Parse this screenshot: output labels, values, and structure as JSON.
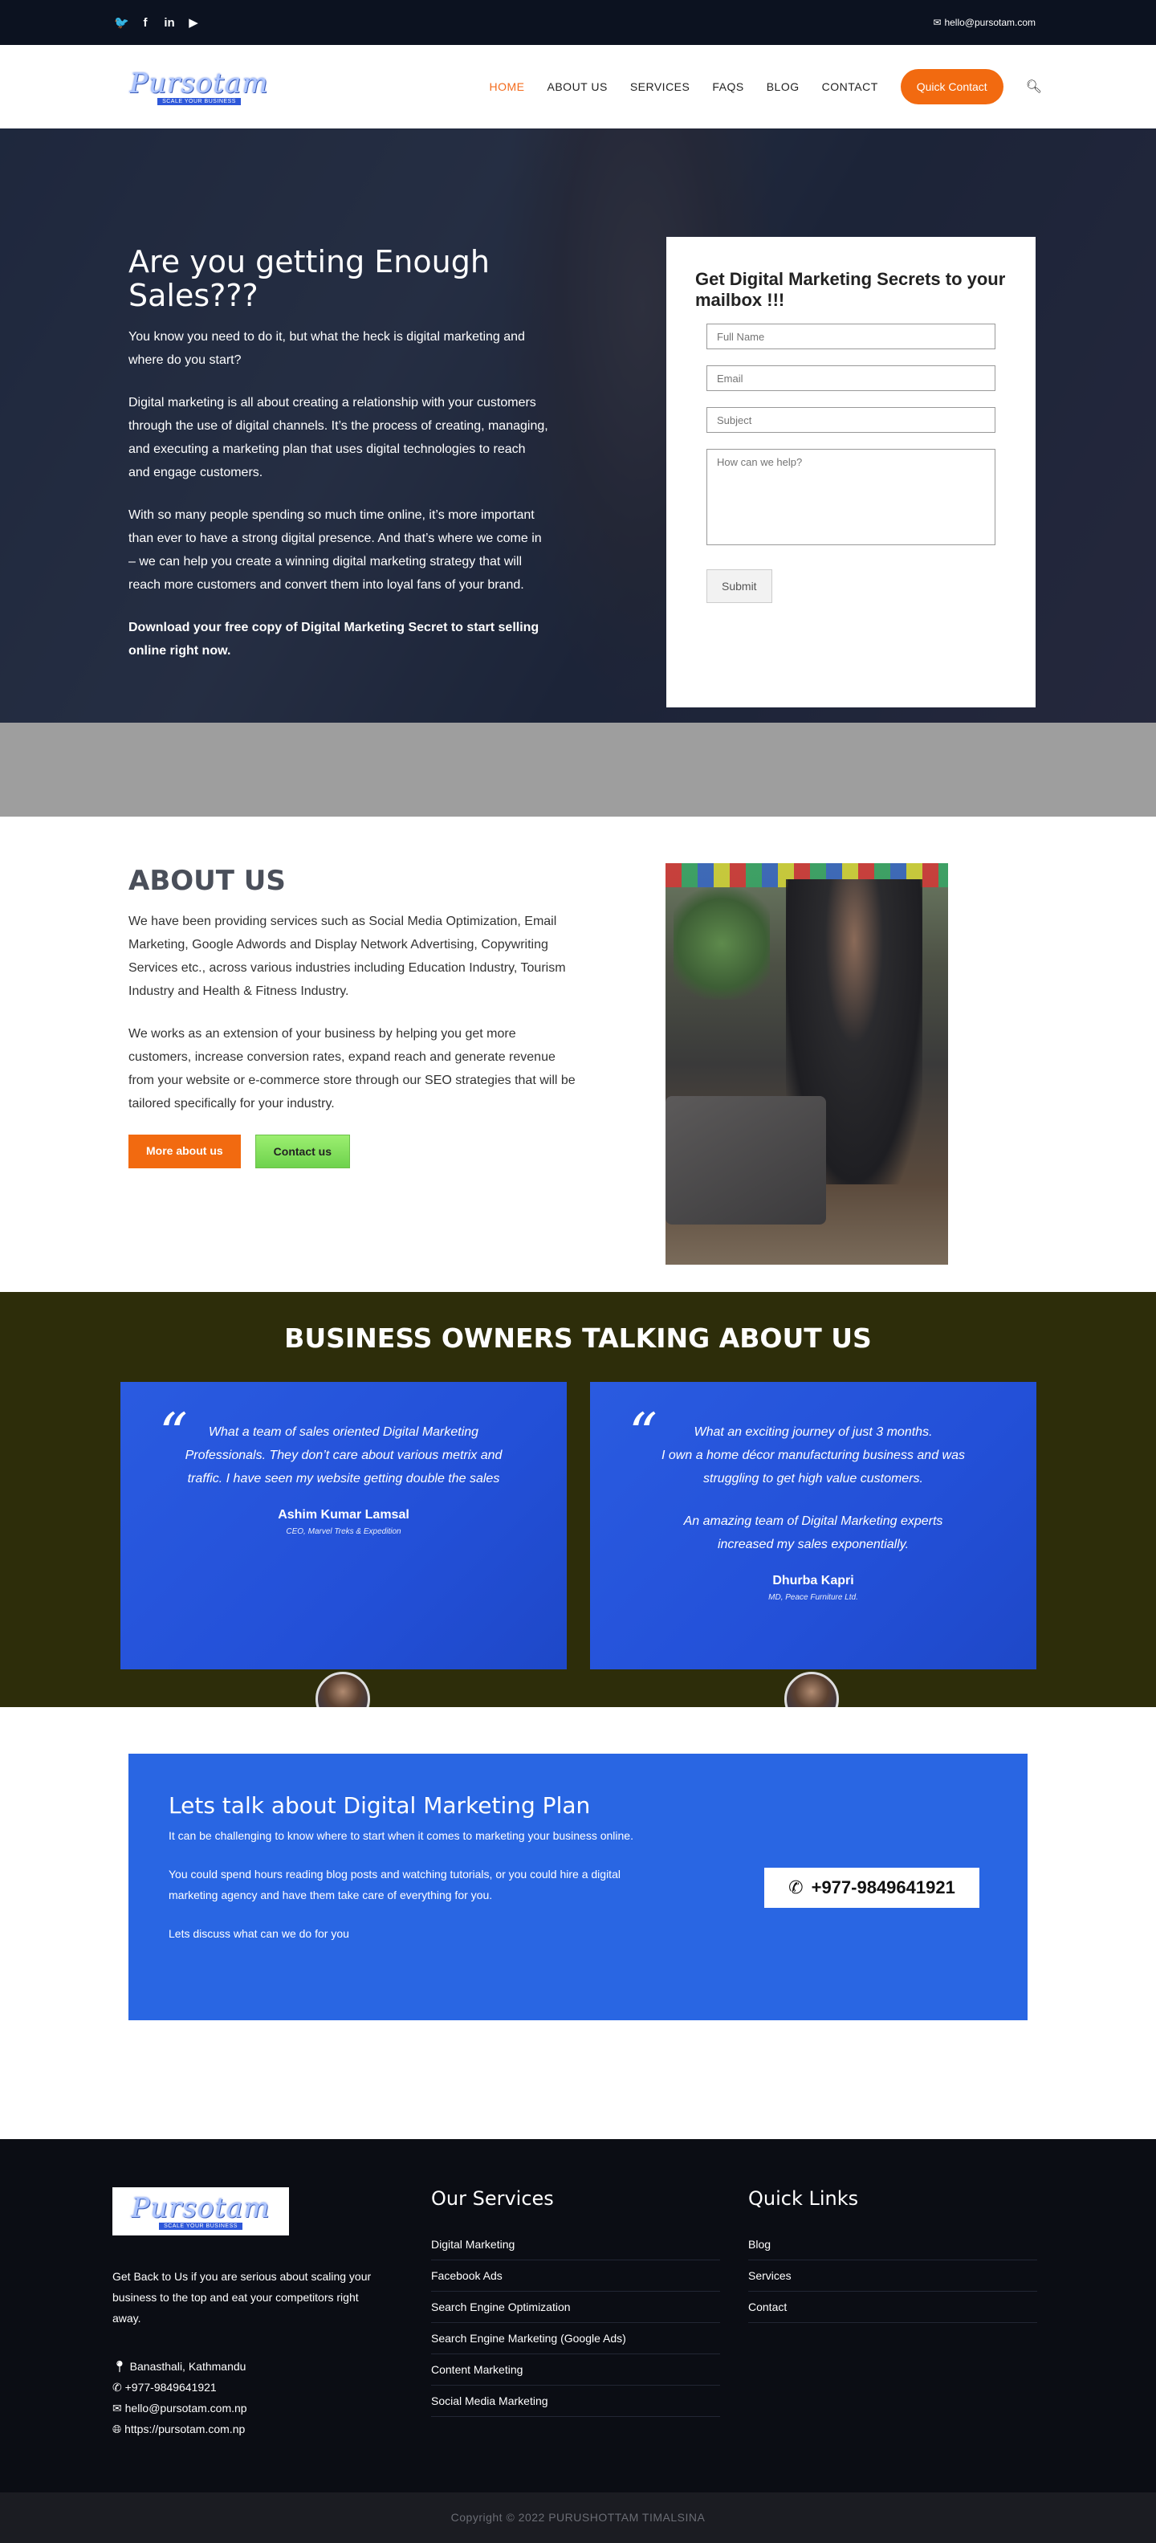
{
  "topbar": {
    "social": [
      "twitter-icon",
      "facebook-icon",
      "linkedin-icon",
      "youtube-icon"
    ],
    "social_glyphs": [
      "🐦",
      "f",
      "in",
      "▶"
    ],
    "email": "hello@pursotam.com"
  },
  "header": {
    "logo_text": "Pursotam",
    "logo_tag": "SCALE YOUR BUSINESS",
    "nav": [
      "HOME",
      "ABOUT US",
      "SERVICES",
      "FAQS",
      "BLOG",
      "CONTACT"
    ],
    "active_nav": "HOME",
    "quick_contact": "Quick Contact"
  },
  "hero": {
    "title": "Are you getting Enough Sales???",
    "p1": "You know you need to do it, but what the heck is digital marketing and where do you start?",
    "p2": "Digital marketing is all about creating a relationship with your customers through the use of digital channels. It’s the process of creating, managing, and executing a marketing plan that uses digital technologies to reach and engage customers.",
    "p3": "With so many people spending so much time online, it’s more important than ever to have a strong digital presence. And that’s where we come in – we can help you create a winning digital marketing strategy that will reach more customers and convert them into loyal fans of your brand.",
    "p4": "Download your free copy of Digital Marketing Secret to start selling online right now.",
    "form": {
      "title": "Get Digital Marketing Secrets to your mailbox !!!",
      "name_placeholder": "Full Name",
      "email_placeholder": "Email",
      "subject_placeholder": "Subject",
      "message_placeholder": "How can we help?",
      "submit": "Submit"
    }
  },
  "about": {
    "title": "ABOUT US",
    "p1": "We have been providing services such as Social Media Optimization, Email Marketing, Google Adwords and Display Network Advertising, Copywriting Services etc., across various industries including Education Industry, Tourism Industry and Health & Fitness Industry.",
    "p2": "We works as an extension of your business by helping you get more customers, increase conversion rates, expand reach and generate revenue from your website or e-commerce store through our SEO strategies that will be tailored specifically for your industry.",
    "more_btn": "More about us",
    "contact_btn": "Contact us"
  },
  "testimonials": {
    "title": "BUSINESS OWNERS TALKING ABOUT US",
    "items": [
      {
        "quote": "What a team of sales oriented Digital Marketing Professionals. They don’t care about various metrix and traffic. I have seen my website getting double the sales",
        "name": "Ashim Kumar Lamsal",
        "role": "CEO, Marvel Treks & Expedition"
      },
      {
        "quote": "What an exciting journey of just 3 months.\nI own a home décor manufacturing business and was struggling to get high value customers.",
        "quote2": "An amazing team of Digital Marketing experts increased my sales exponentially.",
        "name": "Dhurba Kapri",
        "role": "MD, Peace Furniture Ltd."
      }
    ]
  },
  "cta": {
    "title": "Lets talk about Digital Marketing Plan",
    "p1": "It can be challenging to know where to start when it comes to marketing your business online.",
    "p2": "You could spend hours reading blog posts and watching tutorials, or you could hire a digital marketing agency and have them take care of everything for you.",
    "p3": "Lets discuss what can we do for you",
    "phone": "+977-9849641921"
  },
  "footer": {
    "about": "Get Back to Us if you are serious about scaling your business to the top and eat your competitors right away.",
    "address": "Banasthali, Kathmandu",
    "phone": "+977-9849641921",
    "email": "hello@pursotam.com.np",
    "website": "https://pursotam.com.np",
    "services_title": "Our Services",
    "services": [
      "Digital Marketing",
      "Facebook Ads",
      "Search Engine Optimization",
      "Search Engine Marketing (Google Ads)",
      "Content Marketing",
      "Social Media Marketing"
    ],
    "links_title": "Quick Links",
    "links": [
      "Blog",
      "Services",
      "Contact"
    ],
    "copyright": "Copyright © 2022 PURUSHOTTAM TIMALSINA"
  },
  "colors": {
    "accent": "#f26a10",
    "blue": "#2966e3",
    "dark": "#0c1220",
    "testimonial_bg": "#2d2d0a"
  }
}
